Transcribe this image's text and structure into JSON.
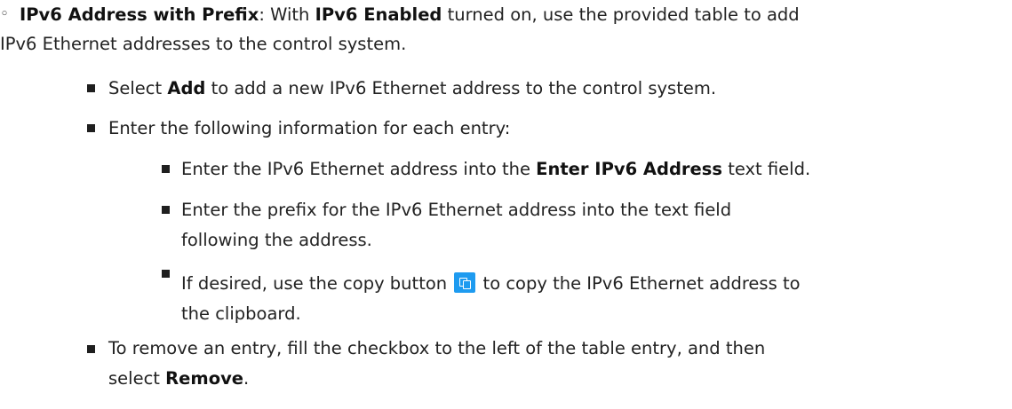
{
  "item": {
    "term": "IPv6 Address with Prefix",
    "t1": ": With ",
    "term2": "IPv6 Enabled",
    "t2": " turned on, use the provided table to add",
    "line2": "IPv6 Ethernet addresses to the control system."
  },
  "add": {
    "t1": "Select ",
    "bold": "Add",
    "t2": " to add a new IPv6 Ethernet address to the control system."
  },
  "enter_info": "Enter the following information for each entry:",
  "enter_addr": {
    "t1": "Enter the IPv6 Ethernet address into the ",
    "bold": "Enter IPv6 Address",
    "t2": " text field."
  },
  "enter_prefix": {
    "line1": "Enter the prefix for the IPv6 Ethernet address into the text field",
    "line2": "following the address."
  },
  "copy": {
    "t1": "If desired, use the copy button",
    "t2": "to copy the IPv6 Ethernet address to",
    "line2": "the clipboard.",
    "icon": "copy-icon",
    "color": "#1e9bf0"
  },
  "remove": {
    "line1": "To remove an entry, fill the checkbox to the left of the table entry, and then",
    "t1": "select ",
    "bold": "Remove",
    "t2": "."
  }
}
